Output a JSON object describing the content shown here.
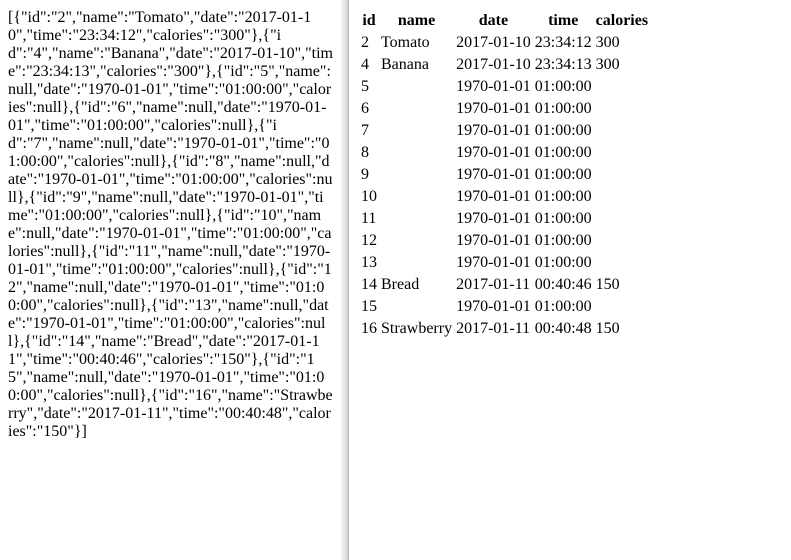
{
  "json_output": "[{\"id\":\"2\",\"name\":\"Tomato\",\"date\":\"2017-01-10\",\"time\":\"23:34:12\",\"calories\":\"300\"},{\"id\":\"4\",\"name\":\"Banana\",\"date\":\"2017-01-10\",\"time\":\"23:34:13\",\"calories\":\"300\"},{\"id\":\"5\",\"name\":null,\"date\":\"1970-01-01\",\"time\":\"01:00:00\",\"calories\":null},{\"id\":\"6\",\"name\":null,\"date\":\"1970-01-01\",\"time\":\"01:00:00\",\"calories\":null},{\"id\":\"7\",\"name\":null,\"date\":\"1970-01-01\",\"time\":\"01:00:00\",\"calories\":null},{\"id\":\"8\",\"name\":null,\"date\":\"1970-01-01\",\"time\":\"01:00:00\",\"calories\":null},{\"id\":\"9\",\"name\":null,\"date\":\"1970-01-01\",\"time\":\"01:00:00\",\"calories\":null},{\"id\":\"10\",\"name\":null,\"date\":\"1970-01-01\",\"time\":\"01:00:00\",\"calories\":null},{\"id\":\"11\",\"name\":null,\"date\":\"1970-01-01\",\"time\":\"01:00:00\",\"calories\":null},{\"id\":\"12\",\"name\":null,\"date\":\"1970-01-01\",\"time\":\"01:00:00\",\"calories\":null},{\"id\":\"13\",\"name\":null,\"date\":\"1970-01-01\",\"time\":\"01:00:00\",\"calories\":null},{\"id\":\"14\",\"name\":\"Bread\",\"date\":\"2017-01-11\",\"time\":\"00:40:46\",\"calories\":\"150\"},{\"id\":\"15\",\"name\":null,\"date\":\"1970-01-01\",\"time\":\"01:00:00\",\"calories\":null},{\"id\":\"16\",\"name\":\"Strawberry\",\"date\":\"2017-01-11\",\"time\":\"00:40:48\",\"calories\":\"150\"}]",
  "table": {
    "headers": {
      "id": "id",
      "name": "name",
      "date": "date",
      "time": "time",
      "calories": "calories"
    },
    "rows": [
      {
        "id": "2",
        "name": "Tomato",
        "date": "2017-01-10",
        "time": "23:34:12",
        "calories": "300"
      },
      {
        "id": "4",
        "name": "Banana",
        "date": "2017-01-10",
        "time": "23:34:13",
        "calories": "300"
      },
      {
        "id": "5",
        "name": "",
        "date": "1970-01-01",
        "time": "01:00:00",
        "calories": ""
      },
      {
        "id": "6",
        "name": "",
        "date": "1970-01-01",
        "time": "01:00:00",
        "calories": ""
      },
      {
        "id": "7",
        "name": "",
        "date": "1970-01-01",
        "time": "01:00:00",
        "calories": ""
      },
      {
        "id": "8",
        "name": "",
        "date": "1970-01-01",
        "time": "01:00:00",
        "calories": ""
      },
      {
        "id": "9",
        "name": "",
        "date": "1970-01-01",
        "time": "01:00:00",
        "calories": ""
      },
      {
        "id": "10",
        "name": "",
        "date": "1970-01-01",
        "time": "01:00:00",
        "calories": ""
      },
      {
        "id": "11",
        "name": "",
        "date": "1970-01-01",
        "time": "01:00:00",
        "calories": ""
      },
      {
        "id": "12",
        "name": "",
        "date": "1970-01-01",
        "time": "01:00:00",
        "calories": ""
      },
      {
        "id": "13",
        "name": "",
        "date": "1970-01-01",
        "time": "01:00:00",
        "calories": ""
      },
      {
        "id": "14",
        "name": "Bread",
        "date": "2017-01-11",
        "time": "00:40:46",
        "calories": "150"
      },
      {
        "id": "15",
        "name": "",
        "date": "1970-01-01",
        "time": "01:00:00",
        "calories": ""
      },
      {
        "id": "16",
        "name": "Strawberry",
        "date": "2017-01-11",
        "time": "00:40:48",
        "calories": "150"
      }
    ]
  }
}
